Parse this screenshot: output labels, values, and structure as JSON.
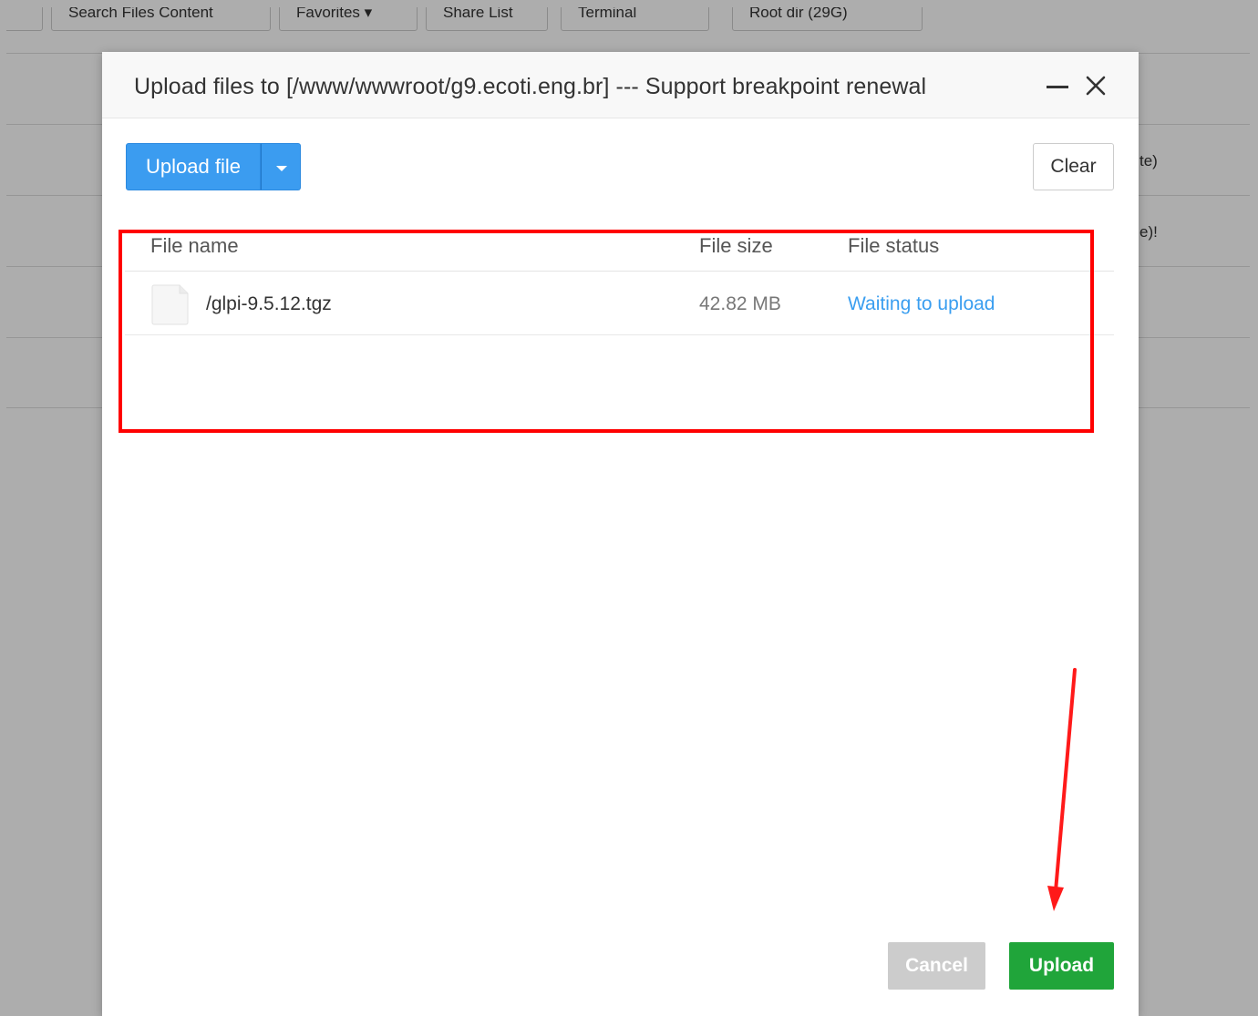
{
  "background": {
    "toolbar_buttons": [
      "Search Files Content",
      "Favorites ▾",
      "Share List",
      "Terminal",
      "Root dir (29G)"
    ],
    "row_texts": [
      "te)",
      "e)!"
    ]
  },
  "modal": {
    "title": "Upload files to [/www/wwwroot/g9.ecoti.eng.br] --- Support breakpoint renewal",
    "upload_file_label": "Upload file",
    "clear_label": "Clear",
    "table": {
      "headers": {
        "name": "File name",
        "size": "File size",
        "status": "File status"
      },
      "rows": [
        {
          "name": "/glpi-9.5.12.tgz",
          "size": "42.82 MB",
          "status": "Waiting to upload"
        }
      ]
    },
    "cancel_label": "Cancel",
    "upload_label": "Upload"
  },
  "colors": {
    "primary_blue": "#3b9cf0",
    "upload_green": "#20a53a",
    "status_blue": "#3a9ef0",
    "annotation_red": "#ff0000",
    "disabled_gray": "#cccccc"
  },
  "icons": {
    "minimize": "minimize-icon",
    "close": "close-icon",
    "dropdown": "caret-down-icon",
    "file": "file-icon"
  }
}
